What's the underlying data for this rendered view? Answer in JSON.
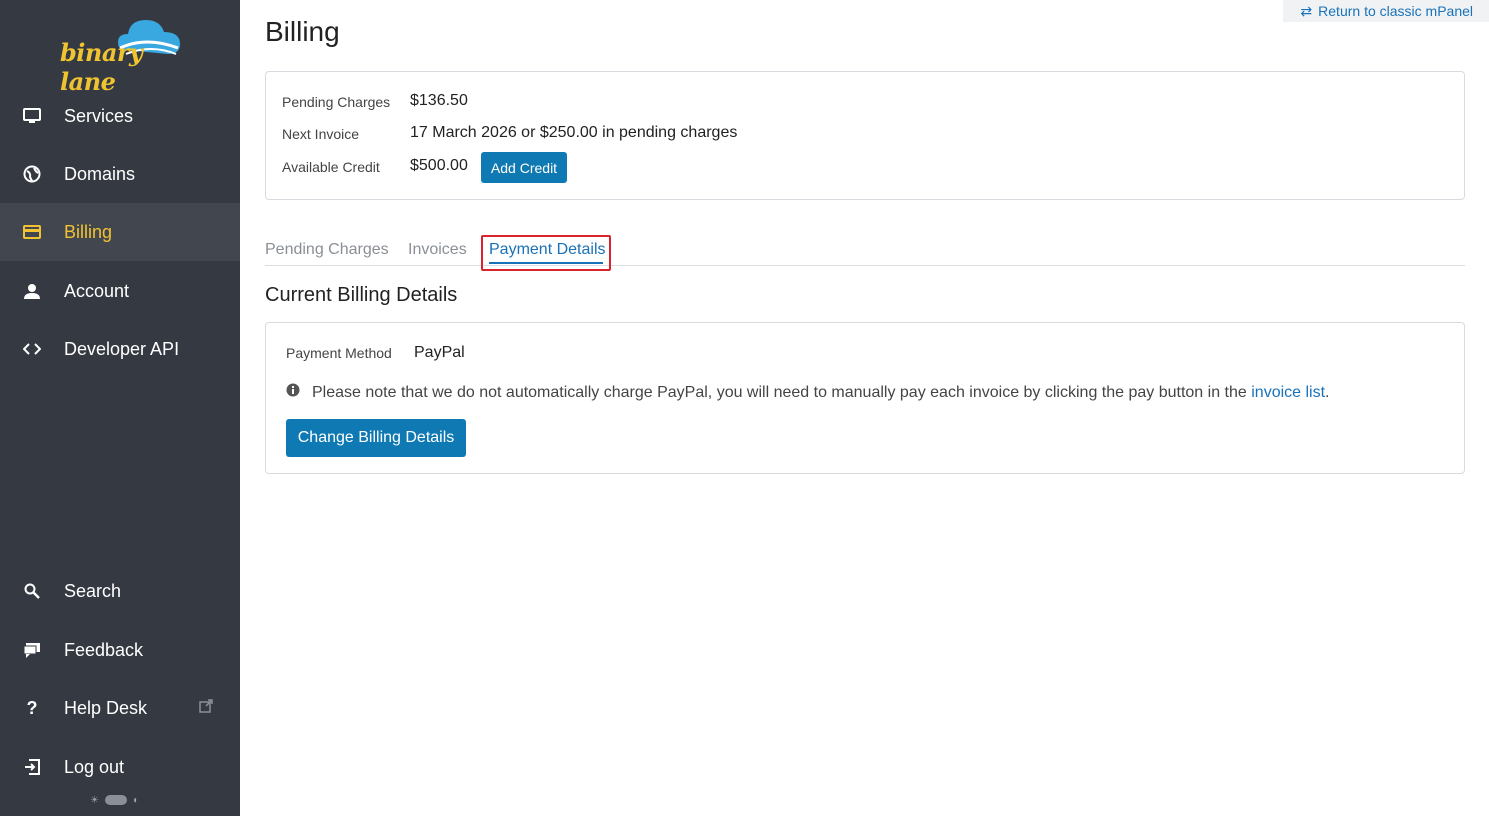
{
  "brand": {
    "logo_text": "binary lane",
    "accent": "#f2c230"
  },
  "sidebar": {
    "items": [
      {
        "label": "Services",
        "icon": "monitor-icon"
      },
      {
        "label": "Domains",
        "icon": "globe-icon"
      },
      {
        "label": "Billing",
        "icon": "credit-card-icon",
        "active": true
      },
      {
        "label": "Account",
        "icon": "user-icon"
      },
      {
        "label": "Developer API",
        "icon": "code-icon"
      }
    ],
    "bottom_items": [
      {
        "label": "Search",
        "icon": "search-icon"
      },
      {
        "label": "Feedback",
        "icon": "chat-icon"
      },
      {
        "label": "Help Desk",
        "icon": "question-icon",
        "external": true
      },
      {
        "label": "Log out",
        "icon": "logout-icon"
      }
    ]
  },
  "header": {
    "return_link": "Return to classic mPanel",
    "title": "Billing"
  },
  "summary": {
    "pending_label": "Pending Charges",
    "pending_value": "$136.50",
    "next_label": "Next Invoice",
    "next_value": "17 March 2026 or $250.00 in pending charges",
    "credit_label": "Available Credit",
    "credit_value": "$500.00",
    "add_credit": "Add Credit"
  },
  "tabs": [
    {
      "label": "Pending Charges"
    },
    {
      "label": "Invoices"
    },
    {
      "label": "Payment Details",
      "active": true
    }
  ],
  "billing": {
    "section_title": "Current Billing Details",
    "method_label": "Payment Method",
    "method_value": "PayPal",
    "note_text": "Please note that we do not automatically charge PayPal, you will need to manually pay each invoice by clicking the pay button in the",
    "note_link": "invoice list",
    "note_end": ".",
    "change_button": "Change Billing Details"
  },
  "colors": {
    "sidebar_bg": "#353a42",
    "primary": "#0e79b2",
    "link": "#1a72b8",
    "highlight": "#d9232d"
  }
}
